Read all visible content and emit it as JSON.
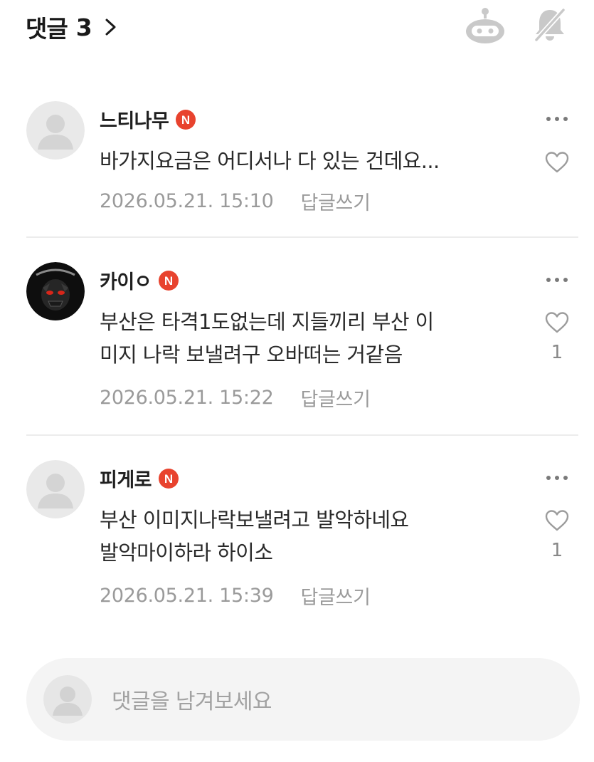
{
  "header": {
    "title": "댓글",
    "count": "3",
    "icons": [
      "chevron-right-icon",
      "robot-icon",
      "bell-off-icon"
    ]
  },
  "comments": [
    {
      "author": "느티나무",
      "avatar": "default-avatar",
      "badge": "N",
      "lines": [
        "바가지요금은 어디서나 다 있는 건데요..."
      ],
      "date": "2026.05.21. 15:10",
      "reply_label": "답글쓰기",
      "likes": ""
    },
    {
      "author": "카이ㅇ",
      "avatar": "dark-skull-avatar",
      "badge": "N",
      "lines": [
        "부산은 타격1도없는데 지들끼리 부산 이",
        "미지 나락 보낼려구 오바떠는 거같음"
      ],
      "date": "2026.05.21. 15:22",
      "reply_label": "답글쓰기",
      "likes": "1"
    },
    {
      "author": "피게로",
      "avatar": "default-avatar",
      "badge": "N",
      "lines": [
        "부산 이미지나락보낼려고 발악하네요",
        "발악마이하라 하이소"
      ],
      "date": "2026.05.21. 15:39",
      "reply_label": "답글쓰기",
      "likes": "1"
    }
  ],
  "composer": {
    "placeholder": "댓글을 남겨보세요"
  },
  "colors": {
    "badge": "#e8432e",
    "muted_text": "#9a9a9a",
    "icon_gray": "#c9c9c9",
    "divider": "#ececec",
    "input_bg": "#f4f4f4"
  }
}
